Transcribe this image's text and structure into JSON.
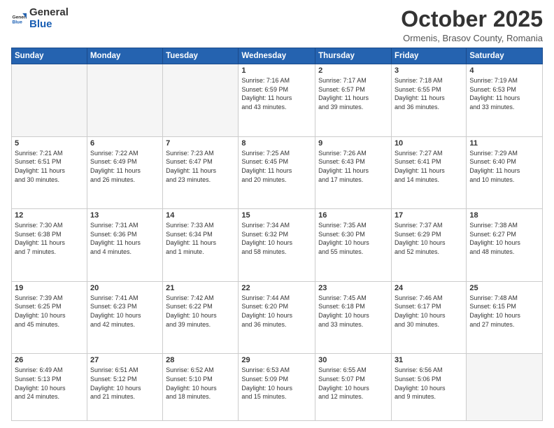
{
  "header": {
    "logo_general": "General",
    "logo_blue": "Blue",
    "month": "October 2025",
    "location": "Ormenis, Brasov County, Romania"
  },
  "days_of_week": [
    "Sunday",
    "Monday",
    "Tuesday",
    "Wednesday",
    "Thursday",
    "Friday",
    "Saturday"
  ],
  "weeks": [
    [
      {
        "day": "",
        "info": ""
      },
      {
        "day": "",
        "info": ""
      },
      {
        "day": "",
        "info": ""
      },
      {
        "day": "1",
        "info": "Sunrise: 7:16 AM\nSunset: 6:59 PM\nDaylight: 11 hours\nand 43 minutes."
      },
      {
        "day": "2",
        "info": "Sunrise: 7:17 AM\nSunset: 6:57 PM\nDaylight: 11 hours\nand 39 minutes."
      },
      {
        "day": "3",
        "info": "Sunrise: 7:18 AM\nSunset: 6:55 PM\nDaylight: 11 hours\nand 36 minutes."
      },
      {
        "day": "4",
        "info": "Sunrise: 7:19 AM\nSunset: 6:53 PM\nDaylight: 11 hours\nand 33 minutes."
      }
    ],
    [
      {
        "day": "5",
        "info": "Sunrise: 7:21 AM\nSunset: 6:51 PM\nDaylight: 11 hours\nand 30 minutes."
      },
      {
        "day": "6",
        "info": "Sunrise: 7:22 AM\nSunset: 6:49 PM\nDaylight: 11 hours\nand 26 minutes."
      },
      {
        "day": "7",
        "info": "Sunrise: 7:23 AM\nSunset: 6:47 PM\nDaylight: 11 hours\nand 23 minutes."
      },
      {
        "day": "8",
        "info": "Sunrise: 7:25 AM\nSunset: 6:45 PM\nDaylight: 11 hours\nand 20 minutes."
      },
      {
        "day": "9",
        "info": "Sunrise: 7:26 AM\nSunset: 6:43 PM\nDaylight: 11 hours\nand 17 minutes."
      },
      {
        "day": "10",
        "info": "Sunrise: 7:27 AM\nSunset: 6:41 PM\nDaylight: 11 hours\nand 14 minutes."
      },
      {
        "day": "11",
        "info": "Sunrise: 7:29 AM\nSunset: 6:40 PM\nDaylight: 11 hours\nand 10 minutes."
      }
    ],
    [
      {
        "day": "12",
        "info": "Sunrise: 7:30 AM\nSunset: 6:38 PM\nDaylight: 11 hours\nand 7 minutes."
      },
      {
        "day": "13",
        "info": "Sunrise: 7:31 AM\nSunset: 6:36 PM\nDaylight: 11 hours\nand 4 minutes."
      },
      {
        "day": "14",
        "info": "Sunrise: 7:33 AM\nSunset: 6:34 PM\nDaylight: 11 hours\nand 1 minute."
      },
      {
        "day": "15",
        "info": "Sunrise: 7:34 AM\nSunset: 6:32 PM\nDaylight: 10 hours\nand 58 minutes."
      },
      {
        "day": "16",
        "info": "Sunrise: 7:35 AM\nSunset: 6:30 PM\nDaylight: 10 hours\nand 55 minutes."
      },
      {
        "day": "17",
        "info": "Sunrise: 7:37 AM\nSunset: 6:29 PM\nDaylight: 10 hours\nand 52 minutes."
      },
      {
        "day": "18",
        "info": "Sunrise: 7:38 AM\nSunset: 6:27 PM\nDaylight: 10 hours\nand 48 minutes."
      }
    ],
    [
      {
        "day": "19",
        "info": "Sunrise: 7:39 AM\nSunset: 6:25 PM\nDaylight: 10 hours\nand 45 minutes."
      },
      {
        "day": "20",
        "info": "Sunrise: 7:41 AM\nSunset: 6:23 PM\nDaylight: 10 hours\nand 42 minutes."
      },
      {
        "day": "21",
        "info": "Sunrise: 7:42 AM\nSunset: 6:22 PM\nDaylight: 10 hours\nand 39 minutes."
      },
      {
        "day": "22",
        "info": "Sunrise: 7:44 AM\nSunset: 6:20 PM\nDaylight: 10 hours\nand 36 minutes."
      },
      {
        "day": "23",
        "info": "Sunrise: 7:45 AM\nSunset: 6:18 PM\nDaylight: 10 hours\nand 33 minutes."
      },
      {
        "day": "24",
        "info": "Sunrise: 7:46 AM\nSunset: 6:17 PM\nDaylight: 10 hours\nand 30 minutes."
      },
      {
        "day": "25",
        "info": "Sunrise: 7:48 AM\nSunset: 6:15 PM\nDaylight: 10 hours\nand 27 minutes."
      }
    ],
    [
      {
        "day": "26",
        "info": "Sunrise: 6:49 AM\nSunset: 5:13 PM\nDaylight: 10 hours\nand 24 minutes."
      },
      {
        "day": "27",
        "info": "Sunrise: 6:51 AM\nSunset: 5:12 PM\nDaylight: 10 hours\nand 21 minutes."
      },
      {
        "day": "28",
        "info": "Sunrise: 6:52 AM\nSunset: 5:10 PM\nDaylight: 10 hours\nand 18 minutes."
      },
      {
        "day": "29",
        "info": "Sunrise: 6:53 AM\nSunset: 5:09 PM\nDaylight: 10 hours\nand 15 minutes."
      },
      {
        "day": "30",
        "info": "Sunrise: 6:55 AM\nSunset: 5:07 PM\nDaylight: 10 hours\nand 12 minutes."
      },
      {
        "day": "31",
        "info": "Sunrise: 6:56 AM\nSunset: 5:06 PM\nDaylight: 10 hours\nand 9 minutes."
      },
      {
        "day": "",
        "info": ""
      }
    ]
  ]
}
